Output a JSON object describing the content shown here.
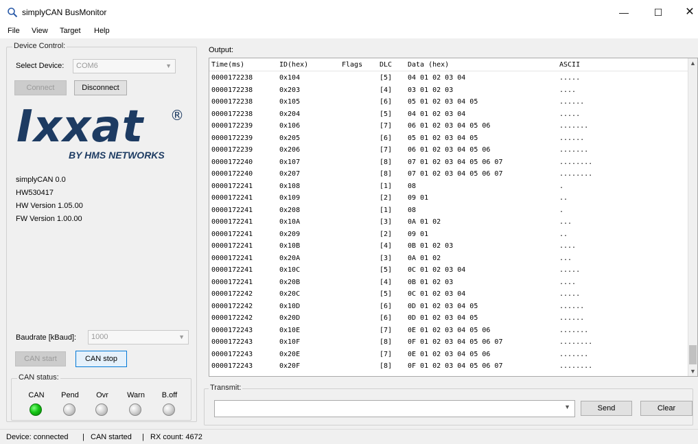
{
  "window": {
    "title": "simplyCAN BusMonitor",
    "minimize": "—",
    "maximize": "☐",
    "close": "✕"
  },
  "menu": [
    "File",
    "View",
    "Target",
    "Help"
  ],
  "device_control": {
    "group_label": "Device Control:",
    "select_device_label": "Select Device:",
    "select_device_value": "COM6",
    "connect_label": "Connect",
    "disconnect_label": "Disconnect",
    "logo_word": "Ixxat",
    "logo_reg": "®",
    "logo_sub": "BY HMS NETWORKS",
    "info": [
      "simplyCAN 0.0",
      "HW530417",
      "HW Version 1.05.00",
      "FW Version 1.00.00"
    ],
    "baudrate_label": "Baudrate [kBaud]:",
    "baudrate_value": "1000",
    "can_start_label": "CAN start",
    "can_stop_label": "CAN stop"
  },
  "can_status": {
    "group_label": "CAN status:",
    "leds": [
      {
        "label": "CAN",
        "on": true
      },
      {
        "label": "Pend",
        "on": false
      },
      {
        "label": "Ovr",
        "on": false
      },
      {
        "label": "Warn",
        "on": false
      },
      {
        "label": "B.off",
        "on": false
      }
    ]
  },
  "output": {
    "label": "Output:",
    "headers": {
      "time": "Time(ms)",
      "id": "ID(hex)",
      "flags": "Flags",
      "dlc": "DLC",
      "data": "Data (hex)",
      "ascii": "ASCII"
    },
    "rows": [
      [
        "0000172238",
        "0x104",
        "[5]",
        "04 01 02 03 04",
        "....."
      ],
      [
        "0000172238",
        "0x203",
        "[4]",
        "03 01 02 03",
        "...."
      ],
      [
        "0000172238",
        "0x105",
        "[6]",
        "05 01 02 03 04 05",
        "......"
      ],
      [
        "0000172238",
        "0x204",
        "[5]",
        "04 01 02 03 04",
        "....."
      ],
      [
        "0000172239",
        "0x106",
        "[7]",
        "06 01 02 03 04 05 06",
        "......."
      ],
      [
        "0000172239",
        "0x205",
        "[6]",
        "05 01 02 03 04 05",
        "......"
      ],
      [
        "0000172239",
        "0x206",
        "[7]",
        "06 01 02 03 04 05 06",
        "......."
      ],
      [
        "0000172240",
        "0x107",
        "[8]",
        "07 01 02 03 04 05 06 07",
        "........"
      ],
      [
        "0000172240",
        "0x207",
        "[8]",
        "07 01 02 03 04 05 06 07",
        "........"
      ],
      [
        "0000172241",
        "0x108",
        "[1]",
        "08",
        "."
      ],
      [
        "0000172241",
        "0x109",
        "[2]",
        "09 01",
        ".."
      ],
      [
        "0000172241",
        "0x208",
        "[1]",
        "08",
        "."
      ],
      [
        "0000172241",
        "0x10A",
        "[3]",
        "0A 01 02",
        "..."
      ],
      [
        "0000172241",
        "0x209",
        "[2]",
        "09 01",
        ".."
      ],
      [
        "0000172241",
        "0x10B",
        "[4]",
        "0B 01 02 03",
        "...."
      ],
      [
        "0000172241",
        "0x20A",
        "[3]",
        "0A 01 02",
        "..."
      ],
      [
        "0000172241",
        "0x10C",
        "[5]",
        "0C 01 02 03 04",
        "....."
      ],
      [
        "0000172241",
        "0x20B",
        "[4]",
        "0B 01 02 03",
        "...."
      ],
      [
        "0000172242",
        "0x20C",
        "[5]",
        "0C 01 02 03 04",
        "....."
      ],
      [
        "0000172242",
        "0x10D",
        "[6]",
        "0D 01 02 03 04 05",
        "......"
      ],
      [
        "0000172242",
        "0x20D",
        "[6]",
        "0D 01 02 03 04 05",
        "......"
      ],
      [
        "0000172243",
        "0x10E",
        "[7]",
        "0E 01 02 03 04 05 06",
        "......."
      ],
      [
        "0000172243",
        "0x10F",
        "[8]",
        "0F 01 02 03 04 05 06 07",
        "........"
      ],
      [
        "0000172243",
        "0x20E",
        "[7]",
        "0E 01 02 03 04 05 06",
        "......."
      ],
      [
        "0000172243",
        "0x20F",
        "[8]",
        "0F 01 02 03 04 05 06 07",
        "........"
      ]
    ]
  },
  "transmit": {
    "label": "Transmit:",
    "value": "",
    "send_label": "Send",
    "clear_label": "Clear"
  },
  "status": {
    "device": "Device: connected",
    "sep": "|",
    "can": "CAN started",
    "rx": "RX count: 4672"
  }
}
